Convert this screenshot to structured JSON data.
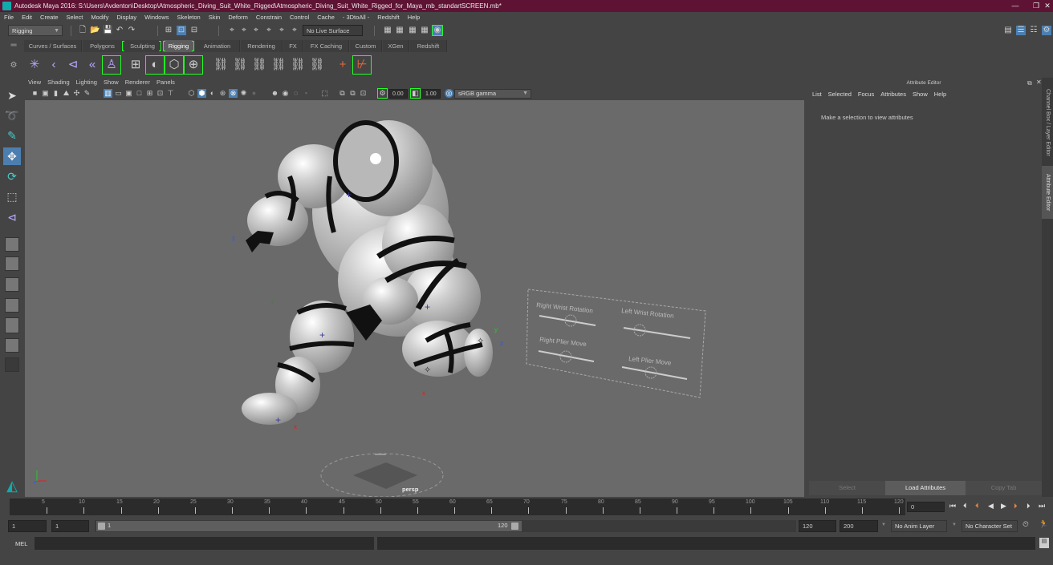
{
  "window": {
    "title": "Autodesk Maya 2016: S:\\Users\\Avdenton\\Desktop\\Atmospheric_Diving_Suit_White_Rigged\\Atmospheric_Diving_Suit_White_Rigged_for_Maya_mb_standartSCREEN.mb*",
    "minimize": "—",
    "restore": "❐",
    "close": "✕"
  },
  "menubar": [
    "File",
    "Edit",
    "Create",
    "Select",
    "Modify",
    "Display",
    "Windows",
    "Skeleton",
    "Skin",
    "Deform",
    "Constrain",
    "Control",
    "Cache",
    "- 3DtoAll -",
    "Redshift",
    "Help"
  ],
  "statusline": {
    "menuset": "Rigging",
    "live_surface": "No Live Surface"
  },
  "shelf": {
    "tabs": [
      "Curves / Surfaces",
      "Polygons",
      "Sculpting",
      "Rigging",
      "Animation",
      "Rendering",
      "FX",
      "FX Caching",
      "Custom",
      "XGen",
      "Redshift"
    ],
    "active_tab": "Rigging"
  },
  "panel": {
    "menus": [
      "View",
      "Shading",
      "Lighting",
      "Show",
      "Renderer",
      "Panels"
    ],
    "exposure": "0.00",
    "gamma": "1.00",
    "color_space": "sRGB gamma"
  },
  "viewport": {
    "camera_label": "persp",
    "control_board": {
      "labels": [
        "Right Wrist Rotation",
        "Left Wrist Rotation",
        "Right Plier Move",
        "Left Plier Move"
      ]
    },
    "axis": {
      "x": "x",
      "y": "y",
      "z": "z"
    }
  },
  "attribute_editor": {
    "title": "Attribute Editor",
    "menus": [
      "List",
      "Selected",
      "Focus",
      "Attributes",
      "Show",
      "Help"
    ],
    "message": "Make a selection to view attributes",
    "buttons": {
      "select": "Select",
      "load": "Load Attributes",
      "copy": "Copy Tab"
    }
  },
  "side_tabs": {
    "channel_box": "Channel Box / Layer Editor",
    "attribute_editor": "Attribute Editor"
  },
  "timeline": {
    "ticks": [
      5,
      10,
      15,
      20,
      25,
      30,
      35,
      40,
      45,
      50,
      55,
      60,
      65,
      70,
      75,
      80,
      85,
      90,
      95,
      100,
      105,
      110,
      115,
      120
    ],
    "current_frame": "0"
  },
  "range": {
    "start": "1",
    "playback_start": "1",
    "slider_start": "1",
    "slider_end": "120",
    "playback_end": "120",
    "end": "200",
    "anim_layer": "No Anim Layer",
    "character_set": "No Character Set"
  },
  "command_line": {
    "label": "MEL"
  }
}
